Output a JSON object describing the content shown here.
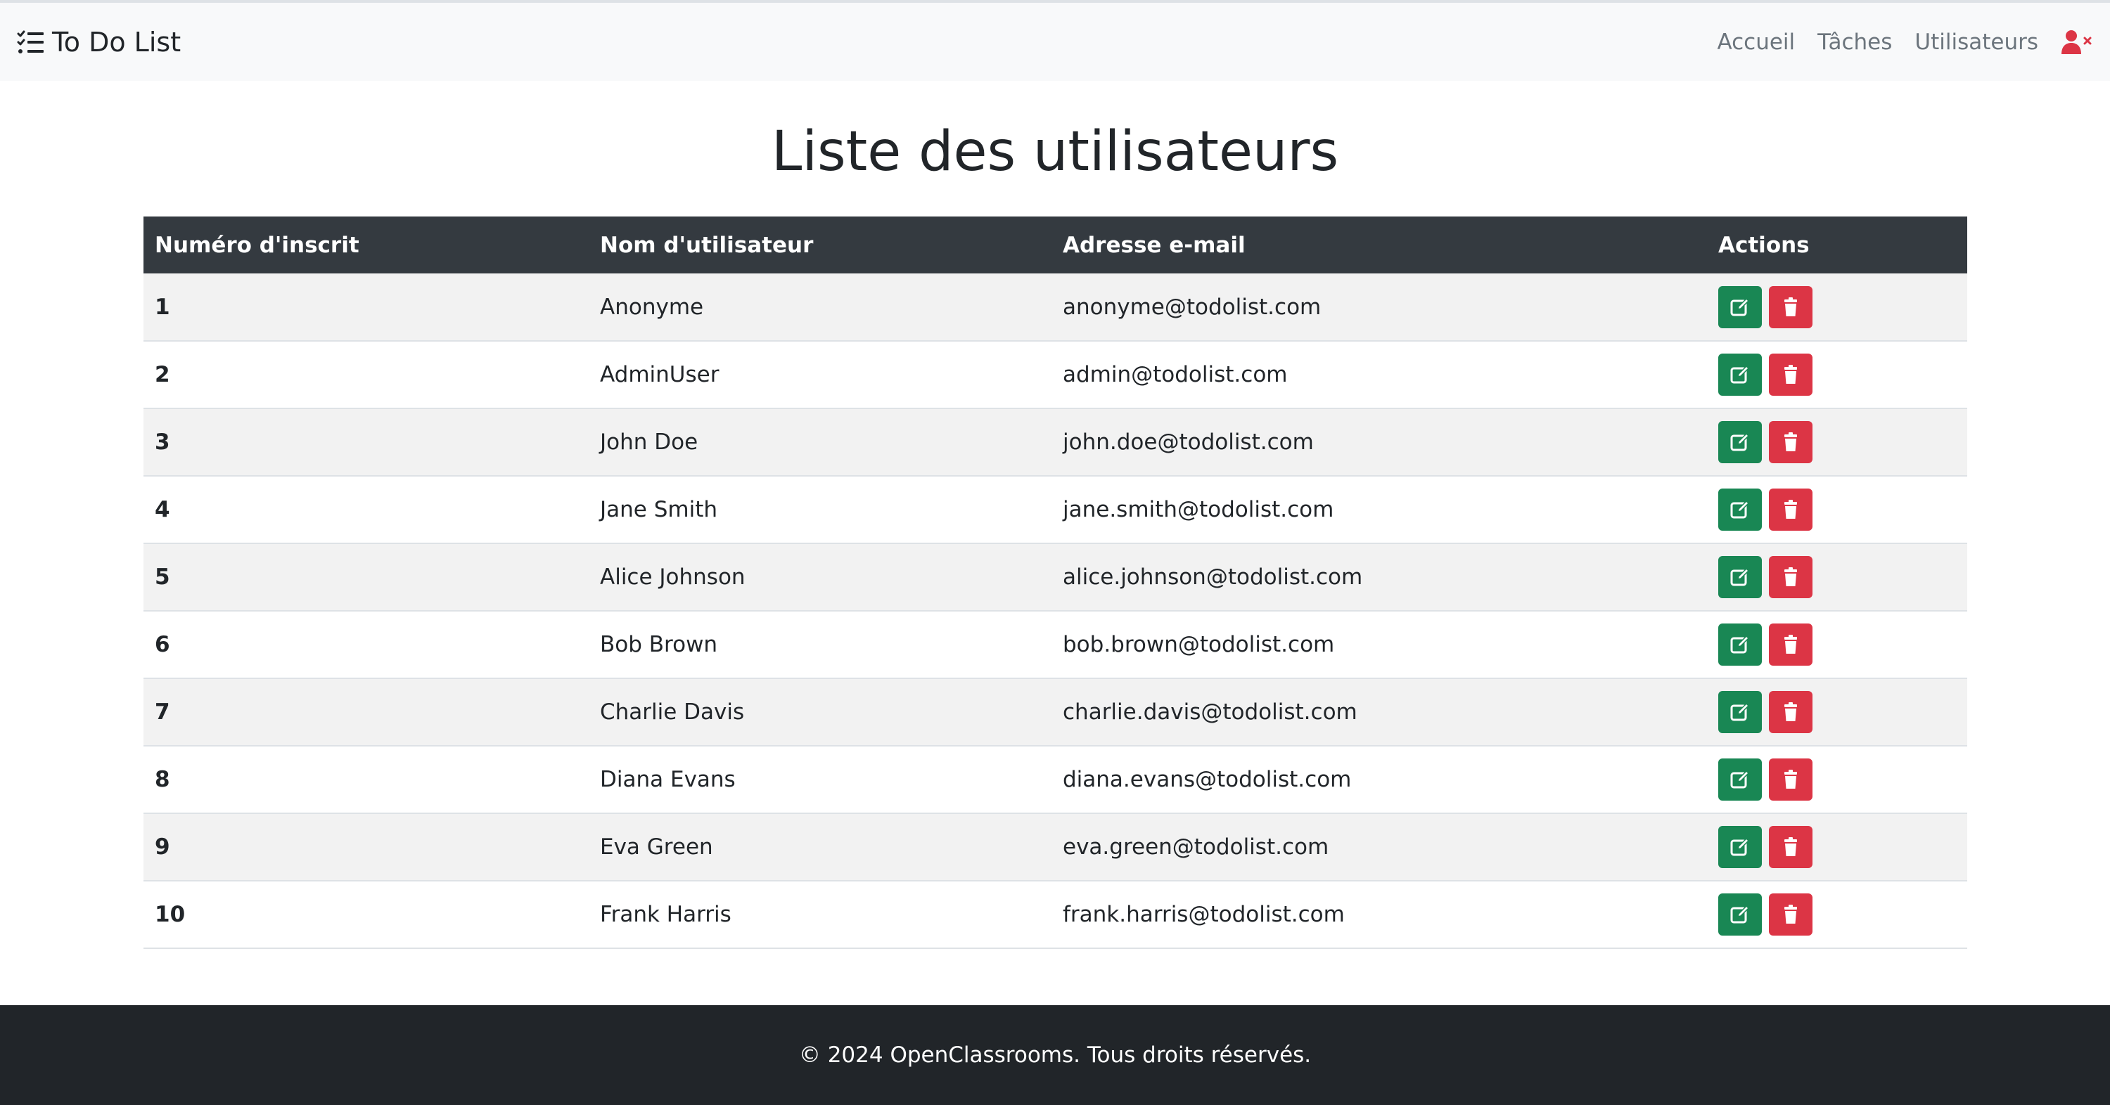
{
  "navbar": {
    "brand": "To Do List",
    "links": [
      {
        "label": "Accueil"
      },
      {
        "label": "Tâches"
      },
      {
        "label": "Utilisateurs"
      }
    ],
    "user_icon": "user-x-icon"
  },
  "main": {
    "title": "Liste des utilisateurs",
    "table": {
      "headers": [
        "Numéro d'inscrit",
        "Nom d'utilisateur",
        "Adresse e-mail",
        "Actions"
      ],
      "rows": [
        {
          "id": "1",
          "username": "Anonyme",
          "email": "anonyme@todolist.com"
        },
        {
          "id": "2",
          "username": "AdminUser",
          "email": "admin@todolist.com"
        },
        {
          "id": "3",
          "username": "John Doe",
          "email": "john.doe@todolist.com"
        },
        {
          "id": "4",
          "username": "Jane Smith",
          "email": "jane.smith@todolist.com"
        },
        {
          "id": "5",
          "username": "Alice Johnson",
          "email": "alice.johnson@todolist.com"
        },
        {
          "id": "6",
          "username": "Bob Brown",
          "email": "bob.brown@todolist.com"
        },
        {
          "id": "7",
          "username": "Charlie Davis",
          "email": "charlie.davis@todolist.com"
        },
        {
          "id": "8",
          "username": "Diana Evans",
          "email": "diana.evans@todolist.com"
        },
        {
          "id": "9",
          "username": "Eva Green",
          "email": "eva.green@todolist.com"
        },
        {
          "id": "10",
          "username": "Frank Harris",
          "email": "frank.harris@todolist.com"
        }
      ],
      "action_icons": {
        "edit": "edit-icon",
        "delete": "trash-icon"
      }
    }
  },
  "footer": {
    "text": "© 2024 OpenClassrooms. Tous droits réservés."
  },
  "colors": {
    "navbar_bg": "#f8f9fa",
    "table_header_bg": "#343a40",
    "edit_button": "#198754",
    "delete_button": "#dc3545",
    "footer_bg": "#212529",
    "user_icon": "#dc3545"
  }
}
